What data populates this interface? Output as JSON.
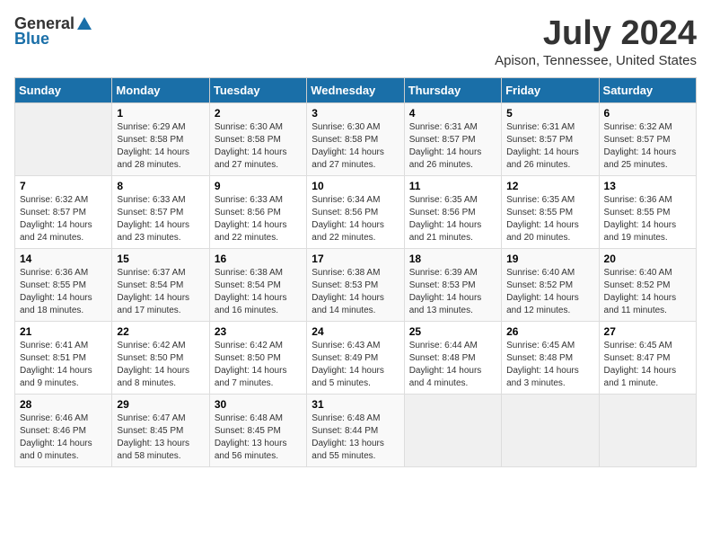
{
  "logo": {
    "general": "General",
    "blue": "Blue"
  },
  "title": {
    "month": "July 2024",
    "location": "Apison, Tennessee, United States"
  },
  "calendar": {
    "headers": [
      "Sunday",
      "Monday",
      "Tuesday",
      "Wednesday",
      "Thursday",
      "Friday",
      "Saturday"
    ],
    "weeks": [
      [
        {
          "day": "",
          "info": ""
        },
        {
          "day": "1",
          "info": "Sunrise: 6:29 AM\nSunset: 8:58 PM\nDaylight: 14 hours\nand 28 minutes."
        },
        {
          "day": "2",
          "info": "Sunrise: 6:30 AM\nSunset: 8:58 PM\nDaylight: 14 hours\nand 27 minutes."
        },
        {
          "day": "3",
          "info": "Sunrise: 6:30 AM\nSunset: 8:58 PM\nDaylight: 14 hours\nand 27 minutes."
        },
        {
          "day": "4",
          "info": "Sunrise: 6:31 AM\nSunset: 8:57 PM\nDaylight: 14 hours\nand 26 minutes."
        },
        {
          "day": "5",
          "info": "Sunrise: 6:31 AM\nSunset: 8:57 PM\nDaylight: 14 hours\nand 26 minutes."
        },
        {
          "day": "6",
          "info": "Sunrise: 6:32 AM\nSunset: 8:57 PM\nDaylight: 14 hours\nand 25 minutes."
        }
      ],
      [
        {
          "day": "7",
          "info": "Sunrise: 6:32 AM\nSunset: 8:57 PM\nDaylight: 14 hours\nand 24 minutes."
        },
        {
          "day": "8",
          "info": "Sunrise: 6:33 AM\nSunset: 8:57 PM\nDaylight: 14 hours\nand 23 minutes."
        },
        {
          "day": "9",
          "info": "Sunrise: 6:33 AM\nSunset: 8:56 PM\nDaylight: 14 hours\nand 22 minutes."
        },
        {
          "day": "10",
          "info": "Sunrise: 6:34 AM\nSunset: 8:56 PM\nDaylight: 14 hours\nand 22 minutes."
        },
        {
          "day": "11",
          "info": "Sunrise: 6:35 AM\nSunset: 8:56 PM\nDaylight: 14 hours\nand 21 minutes."
        },
        {
          "day": "12",
          "info": "Sunrise: 6:35 AM\nSunset: 8:55 PM\nDaylight: 14 hours\nand 20 minutes."
        },
        {
          "day": "13",
          "info": "Sunrise: 6:36 AM\nSunset: 8:55 PM\nDaylight: 14 hours\nand 19 minutes."
        }
      ],
      [
        {
          "day": "14",
          "info": "Sunrise: 6:36 AM\nSunset: 8:55 PM\nDaylight: 14 hours\nand 18 minutes."
        },
        {
          "day": "15",
          "info": "Sunrise: 6:37 AM\nSunset: 8:54 PM\nDaylight: 14 hours\nand 17 minutes."
        },
        {
          "day": "16",
          "info": "Sunrise: 6:38 AM\nSunset: 8:54 PM\nDaylight: 14 hours\nand 16 minutes."
        },
        {
          "day": "17",
          "info": "Sunrise: 6:38 AM\nSunset: 8:53 PM\nDaylight: 14 hours\nand 14 minutes."
        },
        {
          "day": "18",
          "info": "Sunrise: 6:39 AM\nSunset: 8:53 PM\nDaylight: 14 hours\nand 13 minutes."
        },
        {
          "day": "19",
          "info": "Sunrise: 6:40 AM\nSunset: 8:52 PM\nDaylight: 14 hours\nand 12 minutes."
        },
        {
          "day": "20",
          "info": "Sunrise: 6:40 AM\nSunset: 8:52 PM\nDaylight: 14 hours\nand 11 minutes."
        }
      ],
      [
        {
          "day": "21",
          "info": "Sunrise: 6:41 AM\nSunset: 8:51 PM\nDaylight: 14 hours\nand 9 minutes."
        },
        {
          "day": "22",
          "info": "Sunrise: 6:42 AM\nSunset: 8:50 PM\nDaylight: 14 hours\nand 8 minutes."
        },
        {
          "day": "23",
          "info": "Sunrise: 6:42 AM\nSunset: 8:50 PM\nDaylight: 14 hours\nand 7 minutes."
        },
        {
          "day": "24",
          "info": "Sunrise: 6:43 AM\nSunset: 8:49 PM\nDaylight: 14 hours\nand 5 minutes."
        },
        {
          "day": "25",
          "info": "Sunrise: 6:44 AM\nSunset: 8:48 PM\nDaylight: 14 hours\nand 4 minutes."
        },
        {
          "day": "26",
          "info": "Sunrise: 6:45 AM\nSunset: 8:48 PM\nDaylight: 14 hours\nand 3 minutes."
        },
        {
          "day": "27",
          "info": "Sunrise: 6:45 AM\nSunset: 8:47 PM\nDaylight: 14 hours\nand 1 minute."
        }
      ],
      [
        {
          "day": "28",
          "info": "Sunrise: 6:46 AM\nSunset: 8:46 PM\nDaylight: 14 hours\nand 0 minutes."
        },
        {
          "day": "29",
          "info": "Sunrise: 6:47 AM\nSunset: 8:45 PM\nDaylight: 13 hours\nand 58 minutes."
        },
        {
          "day": "30",
          "info": "Sunrise: 6:48 AM\nSunset: 8:45 PM\nDaylight: 13 hours\nand 56 minutes."
        },
        {
          "day": "31",
          "info": "Sunrise: 6:48 AM\nSunset: 8:44 PM\nDaylight: 13 hours\nand 55 minutes."
        },
        {
          "day": "",
          "info": ""
        },
        {
          "day": "",
          "info": ""
        },
        {
          "day": "",
          "info": ""
        }
      ]
    ]
  }
}
